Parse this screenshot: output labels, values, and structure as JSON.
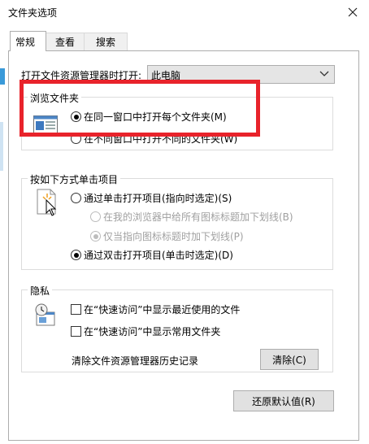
{
  "window": {
    "title": "文件夹选项"
  },
  "tabs": [
    {
      "label": "常规",
      "active": true
    },
    {
      "label": "查看",
      "active": false
    },
    {
      "label": "搜索",
      "active": false
    }
  ],
  "general": {
    "open_explorer_label": "打开文件资源管理器时打开:",
    "open_explorer_value": "此电脑",
    "browse_group": {
      "title": "浏览文件夹",
      "options": [
        {
          "label": "在同一窗口中打开每个文件夹(M)",
          "checked": true
        },
        {
          "label": "在不同窗口中打开不同的文件夹(W)",
          "checked": false
        }
      ]
    },
    "click_group": {
      "title": "按如下方式单击项目",
      "options": [
        {
          "label": "通过单击打开项目(指向时选定)(S)",
          "checked": false,
          "enabled": true
        },
        {
          "label": "在我的浏览器中给所有图标标题加下划线(B)",
          "checked": false,
          "enabled": false
        },
        {
          "label": "仅当指向图标标题时加下划线(P)",
          "checked": true,
          "enabled": false
        },
        {
          "label": "通过双击打开项目(单击时选定)(D)",
          "checked": true,
          "enabled": true
        }
      ]
    },
    "privacy_group": {
      "title": "隐私",
      "checkboxes": [
        {
          "label": "在“快速访问”中显示最近使用的文件",
          "checked": false
        },
        {
          "label": "在“快速访问”中显示常用文件夹",
          "checked": false
        }
      ],
      "clear_label": "清除文件资源管理器历史记录",
      "clear_button": "清除(C)"
    },
    "restore_button": "还原默认值(R)"
  },
  "colors": {
    "highlight": "#e8232b",
    "button_bg": "#e1e1e1",
    "border": "#adadad"
  }
}
